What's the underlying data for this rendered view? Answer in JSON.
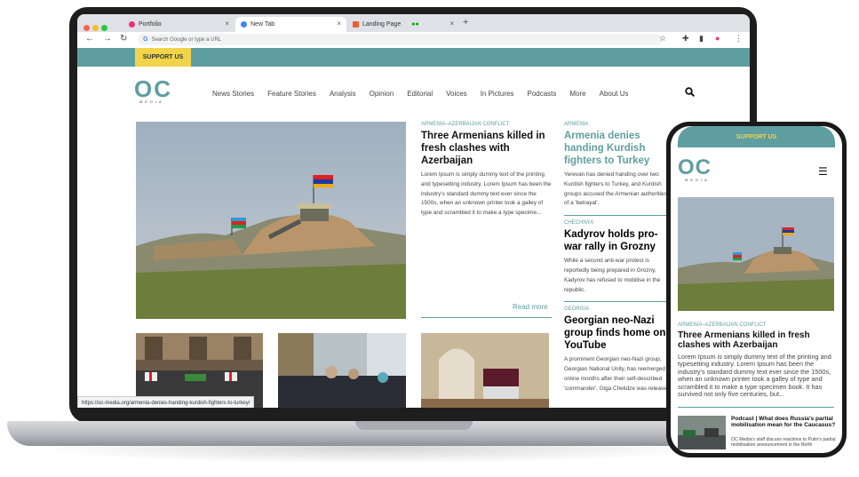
{
  "browser": {
    "tabs": [
      {
        "label": "Portfolio",
        "fav_color": "#e8327a"
      },
      {
        "label": "New Tab",
        "fav_color": "#4285f4"
      },
      {
        "label": "Landing Page",
        "fav_color": "#f25c2a"
      }
    ],
    "new_tab": "+",
    "omnibox_placeholder": "Search Google or type a URL",
    "status_url": "https://oc-media.org/armenia-denies-handing-kurdish-fighters-to-turkey/"
  },
  "site": {
    "support": "SUPPORT US",
    "logo": {
      "oc": "OC",
      "media": "MEDIA"
    },
    "menu": [
      "News Stories",
      "Feature Stories",
      "Analysis",
      "Opinion",
      "Editorial",
      "Voices",
      "In Pictures",
      "Podcasts",
      "More",
      "About Us"
    ],
    "lead": {
      "kicker": "ARMENIA–AZERBAIJAN CONFLICT",
      "title": "Three Armenians killed in fresh clashes with Azerbaijan",
      "body": "Lorem Ipsum is simply dummy text of the printing and typesetting industry. Lorem Ipsum has been the industry's standard dummy text ever since the 1500s, when an unknown printer took a galley of type and scrambled it to make a type specime...",
      "read_more": "Read more"
    },
    "side": [
      {
        "kicker": "ARMENIA",
        "title": "Armenia denies handing Kurdish fighters to Turkey",
        "body": "Yerevan has denied handing over two Kurdish fighters to Turkey, and Kurdish groups accused the Armenian authorities of a 'betrayal'."
      },
      {
        "kicker": "CHECHNYA",
        "title": "Kadyrov holds pro-war rally in Grozny",
        "body": "While a second anti-war protest is reportedly being prepared in Grozny, Kadyrov has refused to mobilise in the republic."
      },
      {
        "kicker": "GEORGIA",
        "title": "Georgian neo-Nazi group finds home on YouTube",
        "body": "A prominent Georgian neo-Nazi group, Georgian National Unity, has reemerged online months after their self-described 'commander', Giga Chelidze was released"
      }
    ]
  },
  "phone": {
    "support": "SUPPORT US",
    "kicker": "ARMENIA–AZERBAIJAN CONFLICT",
    "title": "Three Armenians killed in fresh clashes with Azerbaijan",
    "body": "Lorem Ipsum is simply dummy text of the printing and typesetting industry. Lorem Ipsum has been the industry's standard dummy text ever since the 1500s, when an unknown printer took a galley of type and scrambled it to make a type specimen book. It has survived not only five centuries, but...",
    "podcast_title": "Podcast | What does Russia's partial mobilisation mean for the Caucasus?",
    "podcast_body": "OC Media's staff discuss reactions to Putin's partial mobilisation announcement in the North"
  }
}
